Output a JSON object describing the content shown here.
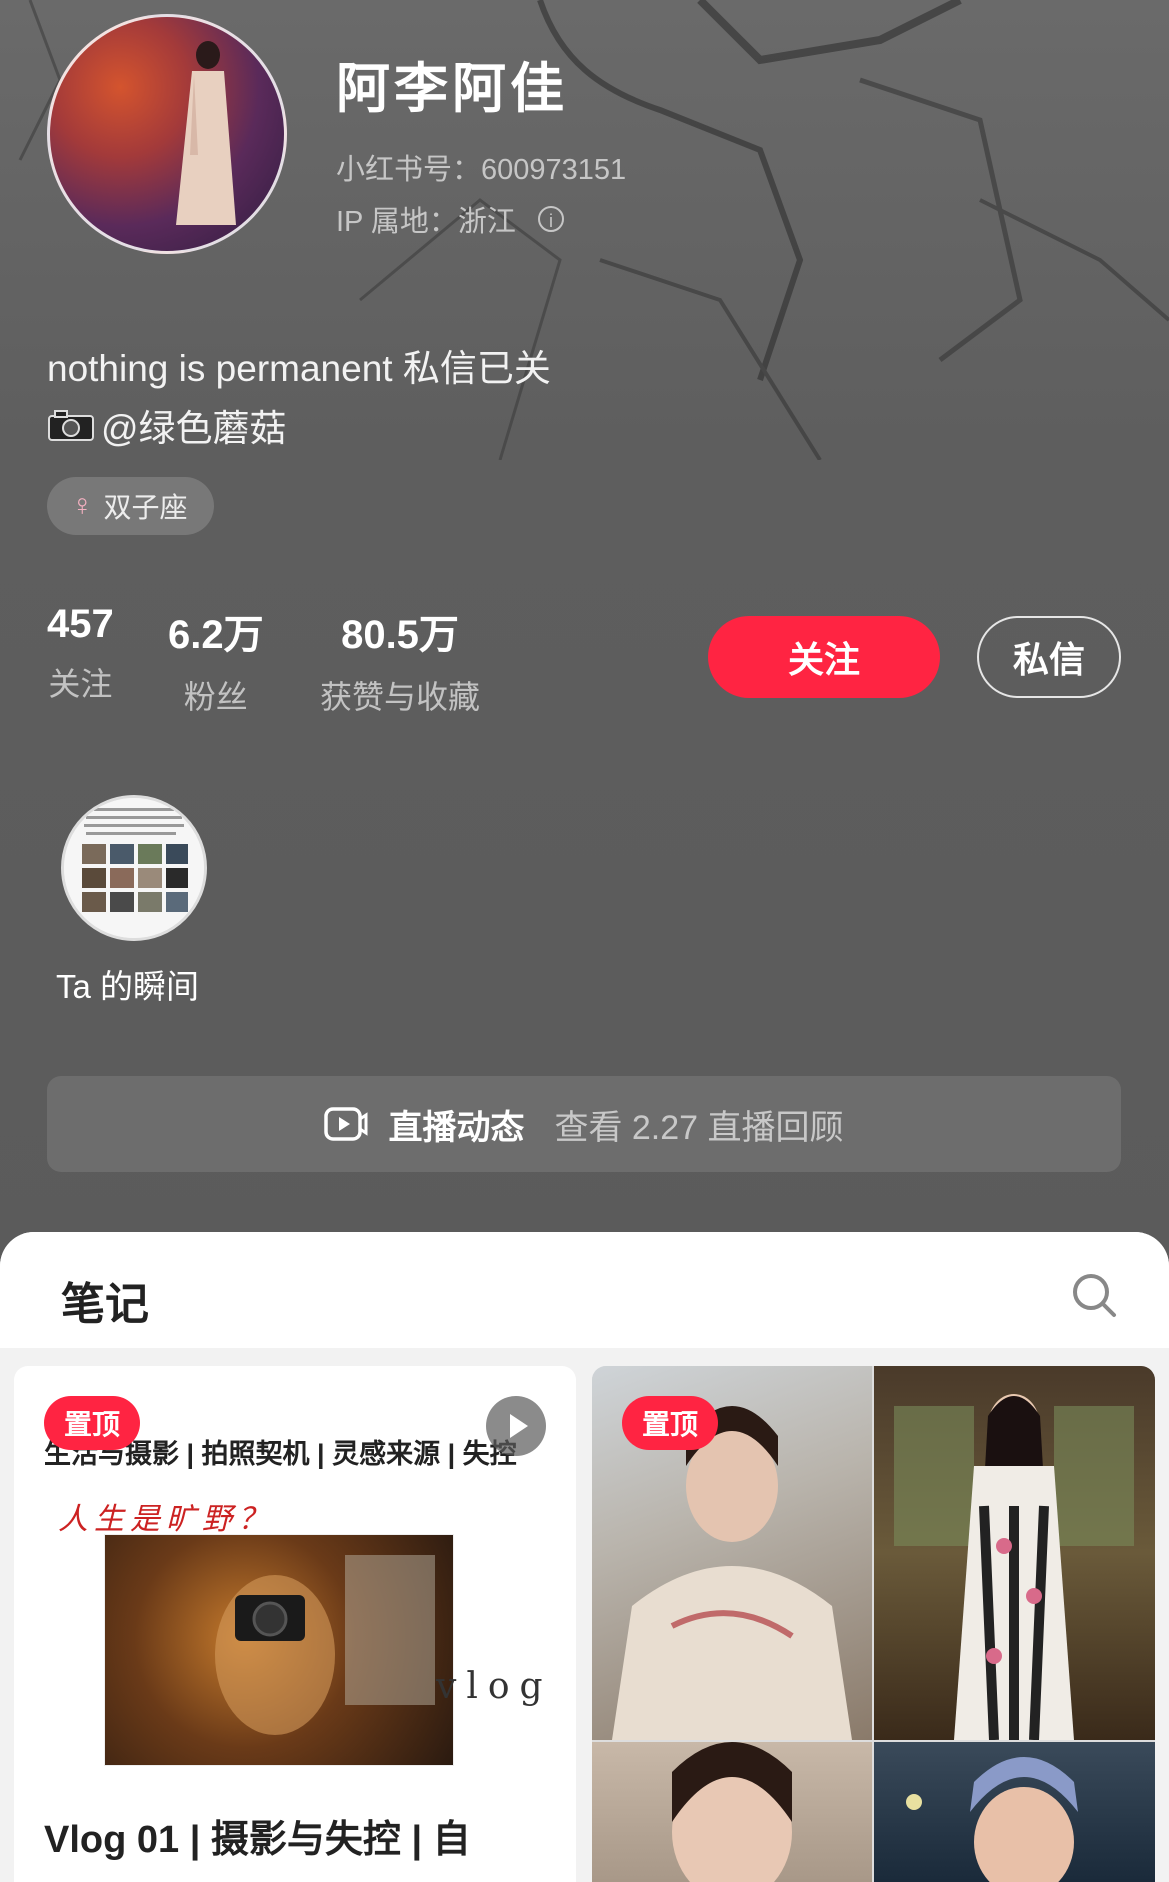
{
  "profile": {
    "name": "阿李阿佳",
    "red_id": "小红书号：600973151",
    "ip_location": "IP 属地：浙江",
    "bio_line1": "nothing is permanent 私信已关",
    "bio_line2": "@绿色蘑菇",
    "tag": "双子座"
  },
  "stats": [
    {
      "value": "457",
      "label": "关注"
    },
    {
      "value": "6.2万",
      "label": "粉丝"
    },
    {
      "value": "80.5万",
      "label": "获赞与收藏"
    }
  ],
  "actions": {
    "follow": "关注",
    "message": "私信"
  },
  "moments": {
    "label": "Ta 的瞬间"
  },
  "live": {
    "title": "直播动态",
    "subtitle": "查看 2.27 直播回顾"
  },
  "notes": {
    "title": "笔记",
    "cards": [
      {
        "pin": "置顶",
        "tags": "生活与摄影 | 拍照契机 | 灵感来源 | 失控",
        "handwriting": "人生是旷野？",
        "word": "vlog",
        "title": "Vlog 01 | 摄影与失控 | 自"
      },
      {
        "pin": "置顶"
      }
    ]
  },
  "colors": {
    "accent": "#ff2442",
    "background": "#5f5f5f"
  }
}
